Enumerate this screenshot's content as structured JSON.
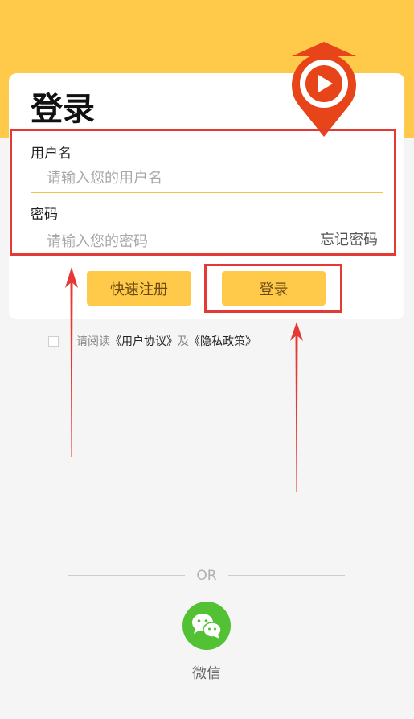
{
  "login_card": {
    "title": "登录",
    "username": {
      "label": "用户名",
      "placeholder": "请输入您的用户名"
    },
    "password": {
      "label": "密码",
      "placeholder": "请输入您的密码"
    },
    "forgot_password": "忘记密码",
    "register_button": "快速注册",
    "login_button": "登录"
  },
  "agreement": {
    "prefix": "请阅读",
    "user_agreement": "《用户协议》",
    "conjunction": "及",
    "privacy_policy": "《隐私政策》"
  },
  "alt_login": {
    "divider_text": "OR",
    "wechat_label": "微信"
  },
  "colors": {
    "brand_yellow": "#ffc94a",
    "logo_red": "#e8441a",
    "annotation_red": "#e53935",
    "wechat_green": "#52c234"
  },
  "icons": {
    "logo": "video-play-location-pin-icon",
    "wechat": "wechat-icon",
    "checkbox": "checkbox-icon"
  }
}
